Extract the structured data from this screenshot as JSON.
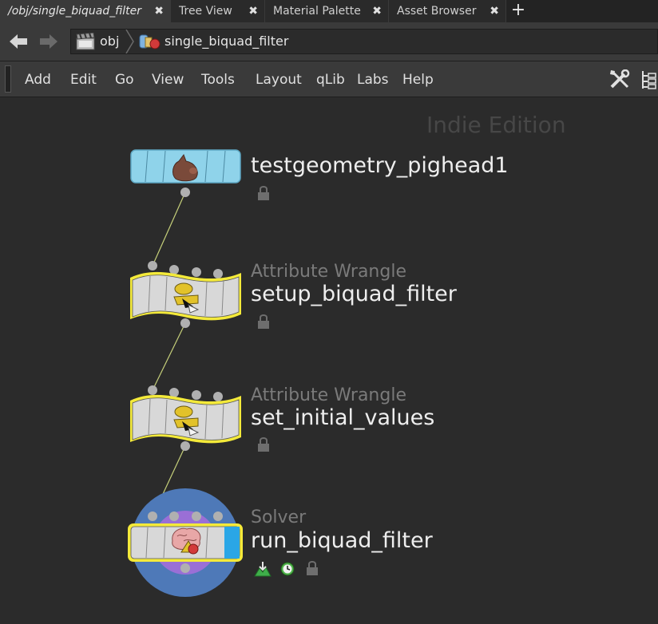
{
  "tabs": [
    {
      "label": "/obj/single_biquad_filter",
      "active": true
    },
    {
      "label": "Tree View"
    },
    {
      "label": "Material Palette"
    },
    {
      "label": "Asset Browser"
    }
  ],
  "tab_close_glyph": "✖",
  "add_tab_glyph": "+",
  "path": {
    "root": "obj",
    "current": "single_biquad_filter"
  },
  "menu": [
    "Add",
    "Edit",
    "Go",
    "View",
    "Tools",
    "Layout",
    "qLib",
    "Labs",
    "Help"
  ],
  "watermark": "Indie Edition",
  "nodes": [
    {
      "name": "testgeometry_pighead1",
      "type": "",
      "color": "#7ed0ea",
      "icon": "pighead-icon"
    },
    {
      "name": "setup_biquad_filter",
      "type": "Attribute Wrangle",
      "color": "#d8d8d8",
      "icon": "wrangle-icon"
    },
    {
      "name": "set_initial_values",
      "type": "Attribute Wrangle",
      "color": "#d8d8d8",
      "icon": "wrangle-icon"
    },
    {
      "name": "run_biquad_filter",
      "type": "Solver",
      "color": "#d8d8d8",
      "icon": "solver-icon",
      "display_flag": true,
      "render_flag": true
    }
  ],
  "colors": {
    "selection": "#f4ea3a",
    "wire": "#c6d07a",
    "display_ring": "#4e79b8",
    "render_ring": "#9a6fd6",
    "solver_flag": "#2aa6e6"
  }
}
